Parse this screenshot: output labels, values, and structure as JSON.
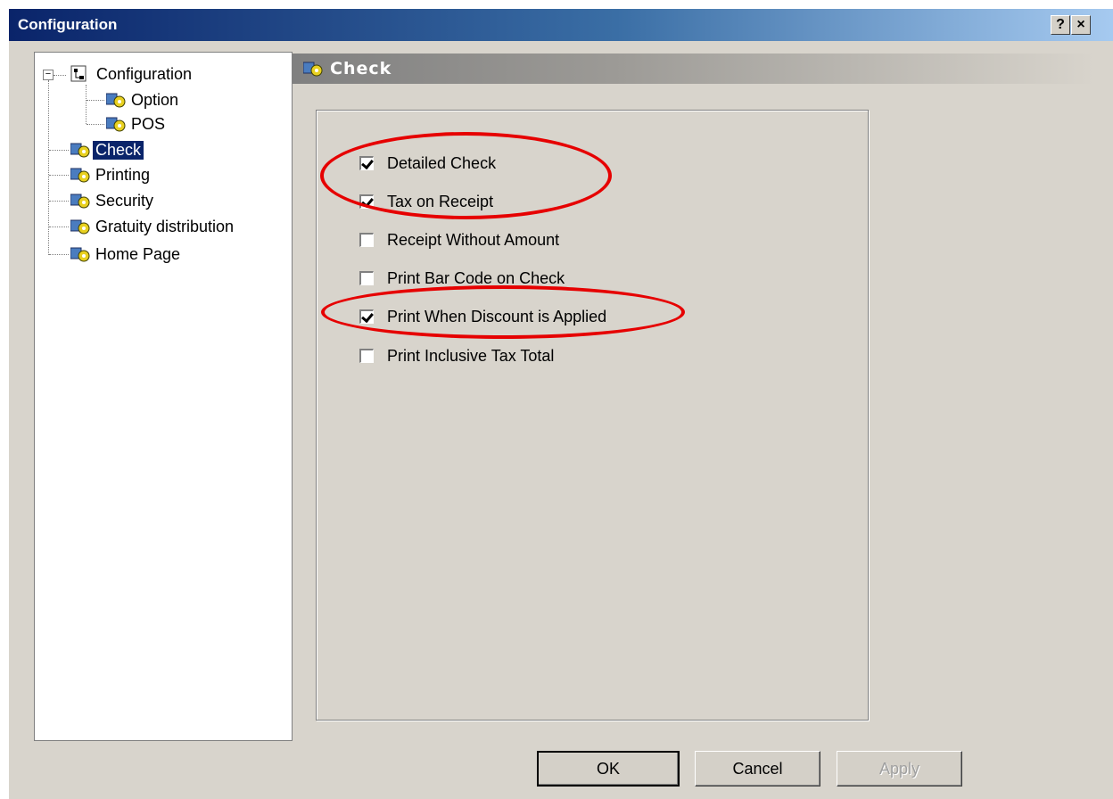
{
  "window": {
    "title": "Configuration",
    "help_button": "?",
    "close_button": "×"
  },
  "tree": {
    "root": "Configuration",
    "items": [
      {
        "label": "Option"
      },
      {
        "label": "POS"
      },
      {
        "label": "Check"
      },
      {
        "label": "Printing"
      },
      {
        "label": "Security"
      },
      {
        "label": "Gratuity distribution"
      },
      {
        "label": "Home Page"
      }
    ],
    "selected": "Check"
  },
  "section": {
    "title": "Check"
  },
  "options": [
    {
      "label": "Detailed Check",
      "checked": true
    },
    {
      "label": "Tax on Receipt",
      "checked": true
    },
    {
      "label": "Receipt Without Amount",
      "checked": false
    },
    {
      "label": "Print Bar Code on Check",
      "checked": false
    },
    {
      "label": "Print When Discount is Applied",
      "checked": true
    },
    {
      "label": "Print Inclusive Tax Total",
      "checked": false
    }
  ],
  "buttons": {
    "ok": "OK",
    "cancel": "Cancel",
    "apply": "Apply"
  },
  "colors": {
    "highlight_ellipse": "#e60000",
    "selection": "#0a246a"
  }
}
